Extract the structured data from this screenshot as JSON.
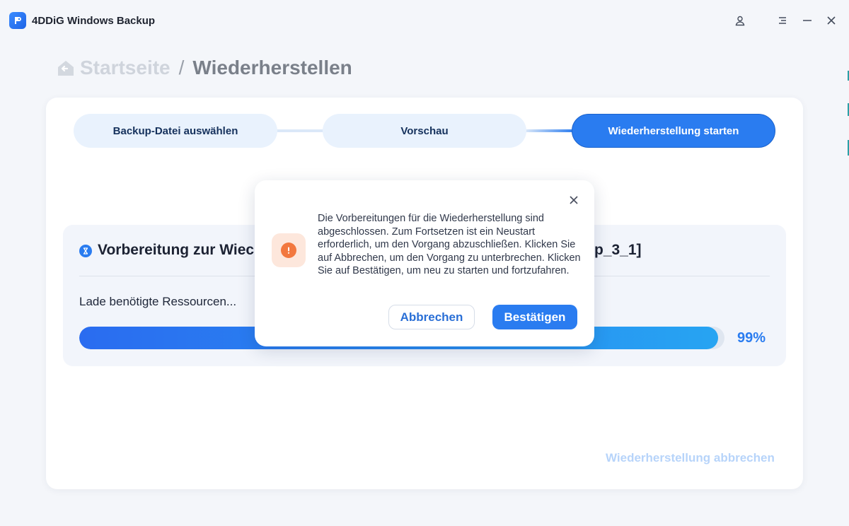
{
  "app": {
    "title": "4DDiG Windows Backup",
    "accent_color": "#2a7cf0",
    "icons": [
      "account-icon",
      "menu-icon",
      "minimize-icon",
      "close-icon"
    ]
  },
  "breadcrumb": {
    "home": "Startseite",
    "separator": "/",
    "current": "Wiederherstellen"
  },
  "steps": [
    {
      "label": "Backup-Datei auswählen",
      "active": false
    },
    {
      "label": "Vorschau",
      "active": false
    },
    {
      "label": "Wiederherstellung starten",
      "active": true
    }
  ],
  "progress_panel": {
    "title": "Vorbereitung zur Wiec",
    "title_suffix": "p_3_1]",
    "status": "Lade benötigte Ressourcen...",
    "percent_label": "99%",
    "percent_value": 99
  },
  "footer": {
    "cancel_restore": "Wiederherstellung abbrechen"
  },
  "dialog": {
    "message": "Die Vorbereitungen für die Wiederherstellung sind abgeschlossen. Zum Fortsetzen ist ein Neustart erforderlich, um den Vorgang abzuschließen. Klicken Sie auf Abbrechen, um den Vorgang zu unterbrechen. Klicken Sie auf Bestätigen, um neu zu starten und fortzufahren.",
    "cancel_label": "Abbrechen",
    "confirm_label": "Bestätigen",
    "icon": "warning-icon",
    "warning_color": "#f2783f"
  }
}
